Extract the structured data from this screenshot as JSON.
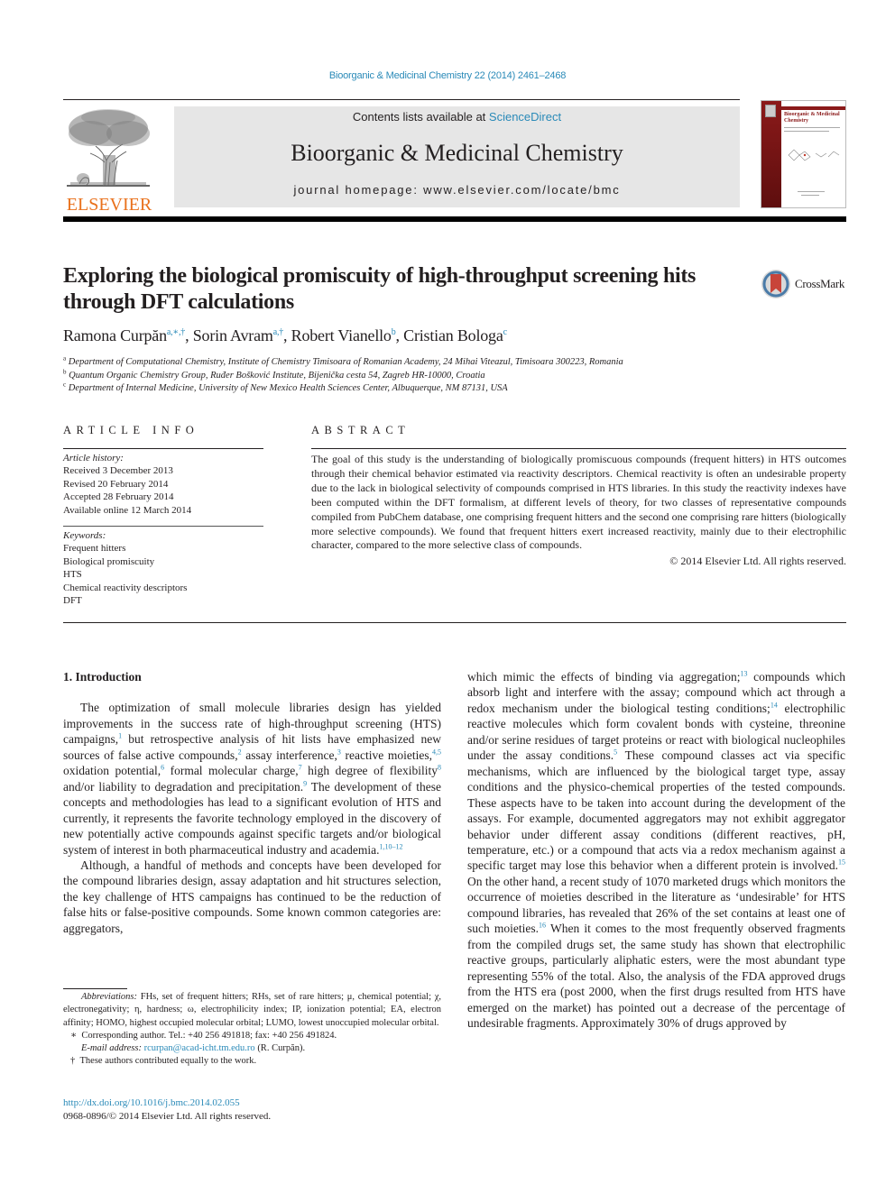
{
  "header": {
    "citation": "Bioorganic & Medicinal Chemistry 22 (2014) 2461–2468",
    "contents_prefix": "Contents lists available at ",
    "contents_link": "ScienceDirect",
    "journal_title": "Bioorganic & Medicinal Chemistry",
    "homepage": "journal homepage: www.elsevier.com/locate/bmc",
    "publisher_logo_text": "ELSEVIER",
    "cover_title": "Bioorganic & Medicinal Chemistry",
    "colors": {
      "link": "#2a8ab8",
      "elsevier_orange": "#e9711c",
      "cover_red": "#8b1a1a",
      "banner_gray": "#e6e6e6"
    }
  },
  "article": {
    "title": "Exploring the biological promiscuity of high-throughput screening hits through DFT calculations",
    "crossmark_label": "CrossMark",
    "authors": [
      {
        "name": "Ramona Curpăn",
        "marks": "a,∗,†"
      },
      {
        "name": "Sorin Avram",
        "marks": "a,†"
      },
      {
        "name": "Robert Vianello",
        "marks": "b"
      },
      {
        "name": "Cristian Bologa",
        "marks": "c"
      }
    ],
    "affiliations": [
      {
        "mark": "a",
        "text": "Department of Computational Chemistry, Institute of Chemistry Timisoara of Romanian Academy, 24 Mihai Viteazul, Timisoara 300223, Romania"
      },
      {
        "mark": "b",
        "text": "Quantum Organic Chemistry Group, Ruđer Bošković Institute, Bijenička cesta 54, Zagreb HR-10000, Croatia"
      },
      {
        "mark": "c",
        "text": "Department of Internal Medicine, University of New Mexico Health Sciences Center, Albuquerque, NM 87131, USA"
      }
    ]
  },
  "article_info": {
    "heading": "ARTICLE INFO",
    "history_label": "Article history:",
    "history": [
      "Received 3 December 2013",
      "Revised 20 February 2014",
      "Accepted 28 February 2014",
      "Available online 12 March 2014"
    ],
    "keywords_label": "Keywords:",
    "keywords": [
      "Frequent hitters",
      "Biological promiscuity",
      "HTS",
      "Chemical reactivity descriptors",
      "DFT"
    ]
  },
  "abstract": {
    "heading": "ABSTRACT",
    "text": "The goal of this study is the understanding of biologically promiscuous compounds (frequent hitters) in HTS outcomes through their chemical behavior estimated via reactivity descriptors. Chemical reactivity is often an undesirable property due to the lack in biological selectivity of compounds comprised in HTS libraries. In this study the reactivity indexes have been computed within the DFT formalism, at different levels of theory, for two classes of representative compounds compiled from PubChem database, one comprising frequent hitters and the second one comprising rare hitters (biologically more selective compounds). We found that frequent hitters exert increased reactivity, mainly due to their electrophilic character, compared to the more selective class of compounds.",
    "copyright": "© 2014 Elsevier Ltd. All rights reserved."
  },
  "body": {
    "section_title": "1. Introduction",
    "left_p1": [
      {
        "t": "The optimization of small molecule libraries design has yielded improvements in the success rate of high-throughput screening (HTS) campaigns,"
      },
      {
        "ref": "1"
      },
      {
        "t": " but retrospective analysis of hit lists have emphasized new sources of false active compounds,"
      },
      {
        "ref": "2"
      },
      {
        "t": " assay interference,"
      },
      {
        "ref": "3"
      },
      {
        "t": " reactive moieties,"
      },
      {
        "ref": "4,5"
      },
      {
        "t": " oxidation potential,"
      },
      {
        "ref": "6"
      },
      {
        "t": " formal molecular charge,"
      },
      {
        "ref": "7"
      },
      {
        "t": " high degree of flexibility"
      },
      {
        "ref": "8"
      },
      {
        "t": " and/or liability to degradation and precipitation."
      },
      {
        "ref": "9"
      },
      {
        "t": " The development of these concepts and methodologies has lead to a significant evolution of HTS and currently, it represents the favorite technology employed in the discovery of new potentially active compounds against specific targets and/or biological system of interest in both pharmaceutical industry and academia."
      },
      {
        "ref": "1,10–12"
      }
    ],
    "left_p2": [
      {
        "t": "Although, a handful of methods and concepts have been developed for the compound libraries design, assay adaptation and hit structures selection, the key challenge of HTS campaigns has continued to be the reduction of false hits or false-positive compounds. Some known common categories are: aggregators,"
      }
    ],
    "right_p1": [
      {
        "t": "which mimic the effects of binding via aggregation;"
      },
      {
        "ref": "13"
      },
      {
        "t": " compounds which absorb light and interfere with the assay; compound which act through a redox mechanism under the biological testing conditions;"
      },
      {
        "ref": "14"
      },
      {
        "t": " electrophilic reactive molecules which form covalent bonds with cysteine, threonine and/or serine residues of target proteins or react with biological nucleophiles under the assay conditions."
      },
      {
        "ref": "5"
      },
      {
        "t": " These compound classes act via specific mechanisms, which are influenced by the biological target type, assay conditions and the physico-chemical properties of the tested compounds. These aspects have to be taken into account during the development of the assays. For example, documented aggregators may not exhibit aggregator behavior under different assay conditions (different reactives, pH, temperature, etc.) or a compound that acts via a redox mechanism against a specific target may lose this behavior when a different protein is involved."
      },
      {
        "ref": "15"
      },
      {
        "t": " On the other hand, a recent study of 1070 marketed drugs which monitors the occurrence of moieties described in the literature as ‘undesirable’ for HTS compound libraries, has revealed that 26% of the set contains at least one of such moieties."
      },
      {
        "ref": "16"
      },
      {
        "t": " When it comes to the most frequently observed fragments from the compiled drugs set, the same study has shown that electrophilic reactive groups, particularly aliphatic esters, were the most abundant type representing 55% of the total. Also, the analysis of the FDA approved drugs from the HTS era (post 2000, when the first drugs resulted from HTS have emerged on the market) has pointed out a decrease of the percentage of undesirable fragments. Approximately 30% of drugs approved by"
      }
    ]
  },
  "footnotes": {
    "abbreviations_label": "Abbreviations:",
    "abbreviations_text": " FHs, set of frequent hitters; RHs, set of rare hitters; μ, chemical potential; χ, electronegativity; η, hardness; ω, electrophilicity index; IP, ionization potential; EA, electron affinity; HOMO, highest occupied molecular orbital; LUMO, lowest unoccupied molecular orbital.",
    "corresponding_mark": "∗",
    "corresponding": "Corresponding author. Tel.: +40 256 491818; fax: +40 256 491824.",
    "email_label": "E-mail address:",
    "email": "rcurpan@acad-icht.tm.edu.ro",
    "email_suffix": " (R. Curpăn).",
    "equal_mark": "†",
    "equal": "These authors contributed equally to the work.",
    "doi": "http://dx.doi.org/10.1016/j.bmc.2014.02.055",
    "issn": "0968-0896/© 2014 Elsevier Ltd. All rights reserved."
  }
}
